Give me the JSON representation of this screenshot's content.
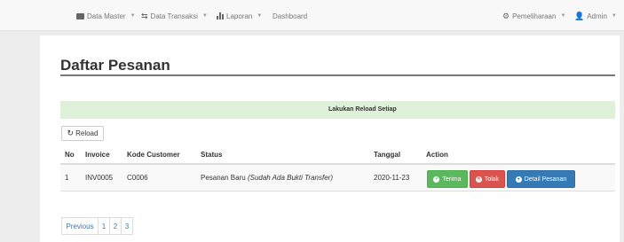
{
  "navbar": {
    "data_master": "Data Master",
    "data_transaksi": "Data Transaksi",
    "laporan": "Laporan",
    "dashboard": "Dashboard",
    "pemeliharaan": "Pemeliharaan",
    "admin": "Admin"
  },
  "page": {
    "title": "Daftar Pesanan",
    "reload_notice": "Lakukan Reload Setiap",
    "reload_button": "Reload"
  },
  "table": {
    "headers": [
      "No",
      "Invoice",
      "Kode Customer",
      "Status",
      "Tanggal",
      "Action"
    ],
    "rows": [
      {
        "no": "1",
        "invoice": "INV0005",
        "kode_customer": "C0006",
        "status": "Pesanan Baru",
        "status_note": "(Sudah Ada Bukti Transfer)",
        "tanggal": "2020-11-23",
        "action_terima": "Terima",
        "action_tolak": "Tolak",
        "action_detail": "Detail Pesanan"
      }
    ]
  },
  "pagination": {
    "previous": "Previous",
    "pages": [
      "1",
      "2",
      "3"
    ]
  },
  "colors": {
    "success": "#5cb85c",
    "danger": "#d9534f",
    "primary": "#337ab7",
    "notice_bg": "#dff0d8",
    "link": "#337ab7"
  },
  "icons": {
    "data_master": "folder-icon",
    "data_transaksi": "retweet-icon",
    "laporan": "bar-chart-icon",
    "pemeliharaan": "gear-icon",
    "admin": "user-icon",
    "reload": "refresh-icon",
    "terima": "check-circle-icon",
    "tolak": "times-circle-icon",
    "detail": "eye-icon"
  }
}
